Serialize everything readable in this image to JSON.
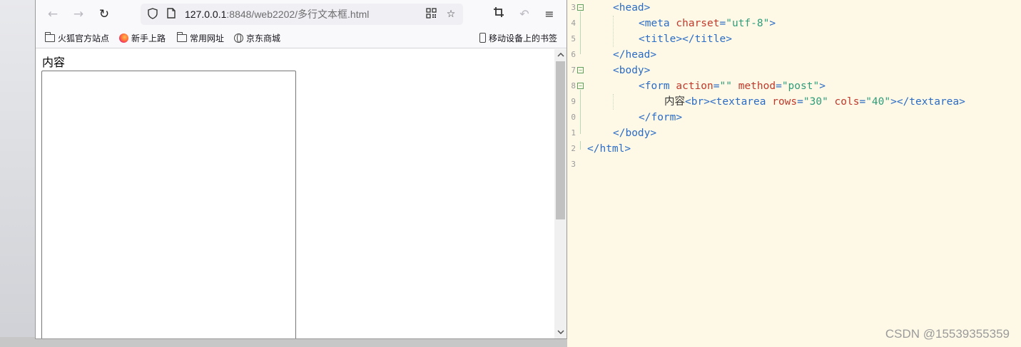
{
  "browser": {
    "url_host": "127.0.0.1",
    "url_path": ":8848/web2202/多行文本框.html",
    "bookmarks": [
      {
        "label": "火狐官方站点",
        "icon": "folder-icon"
      },
      {
        "label": "新手上路",
        "icon": "firefox-icon"
      },
      {
        "label": "常用网址",
        "icon": "folder-icon"
      },
      {
        "label": "京东商城",
        "icon": "globe-icon"
      }
    ],
    "mobile_bookmarks": "移动设备上的书签"
  },
  "page": {
    "label": "内容",
    "textarea_value": ""
  },
  "editor": {
    "line_numbers": [
      "3",
      "4",
      "5",
      "6",
      "7",
      "8",
      "9",
      "0",
      "1",
      "2",
      "3"
    ],
    "lines": {
      "l3_tag": "<head>",
      "l4_a": "<meta ",
      "l4_b": "charset",
      "l4_c": "=",
      "l4_d": "\"utf-8\"",
      "l4_e": ">",
      "l5_tag": "<title></title>",
      "l6_tag": "</head>",
      "l7_tag": "<body>",
      "l8_a": "<form ",
      "l8_b": "action",
      "l8_c": "=",
      "l8_d": "\"\"",
      "l8_e": " method",
      "l8_f": "=",
      "l8_g": "\"post\"",
      "l8_h": ">",
      "l9_a": "内容",
      "l9_b": "<br><textarea ",
      "l9_c": "rows",
      "l9_d": "=",
      "l9_e": "\"30\"",
      "l9_f": " cols",
      "l9_g": "=",
      "l9_h": "\"40\"",
      "l9_i": "></textarea>",
      "l10_tag": "</form>",
      "l11_tag": "</body>",
      "l12_tag": "</html>"
    }
  },
  "watermark": "CSDN @15539355359"
}
